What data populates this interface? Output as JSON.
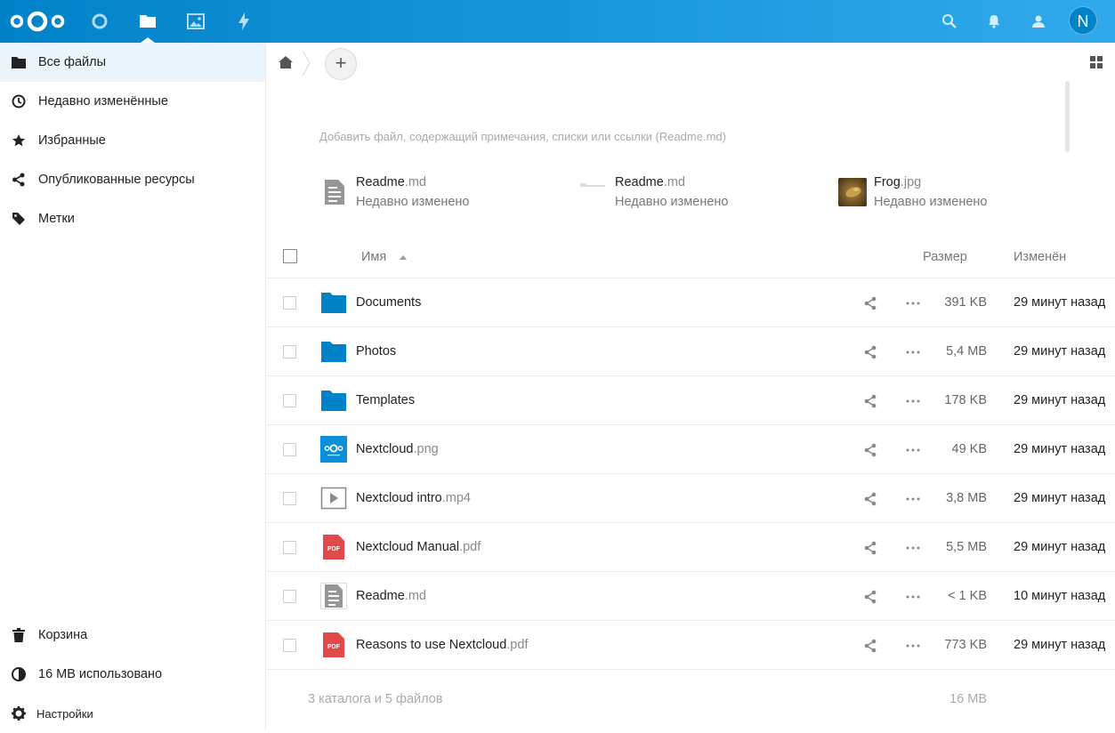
{
  "header": {
    "avatar_initial": "N",
    "apps": [
      "dashboard-icon",
      "files-icon",
      "photos-icon",
      "activity-icon"
    ],
    "right_icons": [
      "search-icon",
      "notifications-icon",
      "contacts-icon"
    ],
    "brand_color": "#0082c9"
  },
  "sidebar": {
    "items": [
      {
        "label": "Все файлы",
        "icon": "folder-icon"
      },
      {
        "label": "Недавно изменённые",
        "icon": "clock-icon"
      },
      {
        "label": "Избранные",
        "icon": "star-icon"
      },
      {
        "label": "Опубликованные ресурсы",
        "icon": "share-icon"
      },
      {
        "label": "Метки",
        "icon": "tag-icon"
      }
    ],
    "trash_label": "Корзина",
    "quota_label": "16 MB использовано",
    "settings_label": "Настройки"
  },
  "main": {
    "readme_placeholder": "Добавить файл, содержащий примечания, списки или ссылки (Readme.md)",
    "recent": [
      {
        "name": "Readme",
        "ext": ".md",
        "sub": "Недавно изменено",
        "thumb": "text-file-icon"
      },
      {
        "name": "Readme",
        "ext": ".md",
        "sub": "Недавно изменено",
        "thumb": "text-preview-icon"
      },
      {
        "name": "Frog",
        "ext": ".jpg",
        "sub": "Недавно изменено",
        "thumb": "frog-thumbnail"
      }
    ],
    "columns": {
      "name": "Имя",
      "size": "Размер",
      "modified": "Изменён"
    },
    "files": [
      {
        "name": "Documents",
        "ext": "",
        "size": "391 KB",
        "modified": "29 минут назад",
        "type": "folder"
      },
      {
        "name": "Photos",
        "ext": "",
        "size": "5,4 MB",
        "modified": "29 минут назад",
        "type": "folder"
      },
      {
        "name": "Templates",
        "ext": "",
        "size": "178 KB",
        "modified": "29 минут назад",
        "type": "folder"
      },
      {
        "name": "Nextcloud",
        "ext": ".png",
        "size": "49 KB",
        "modified": "29 минут назад",
        "type": "image"
      },
      {
        "name": "Nextcloud intro",
        "ext": ".mp4",
        "size": "3,8 MB",
        "modified": "29 минут назад",
        "type": "video"
      },
      {
        "name": "Nextcloud Manual",
        "ext": ".pdf",
        "size": "5,5 MB",
        "modified": "29 минут назад",
        "type": "pdf"
      },
      {
        "name": "Readme",
        "ext": ".md",
        "size": "< 1 KB",
        "modified": "10 минут назад",
        "type": "text"
      },
      {
        "name": "Reasons to use Nextcloud",
        "ext": ".pdf",
        "size": "773 KB",
        "modified": "29 минут назад",
        "type": "pdf"
      }
    ],
    "summary": "3 каталога и 5 файлов",
    "summary_size": "16 MB"
  }
}
